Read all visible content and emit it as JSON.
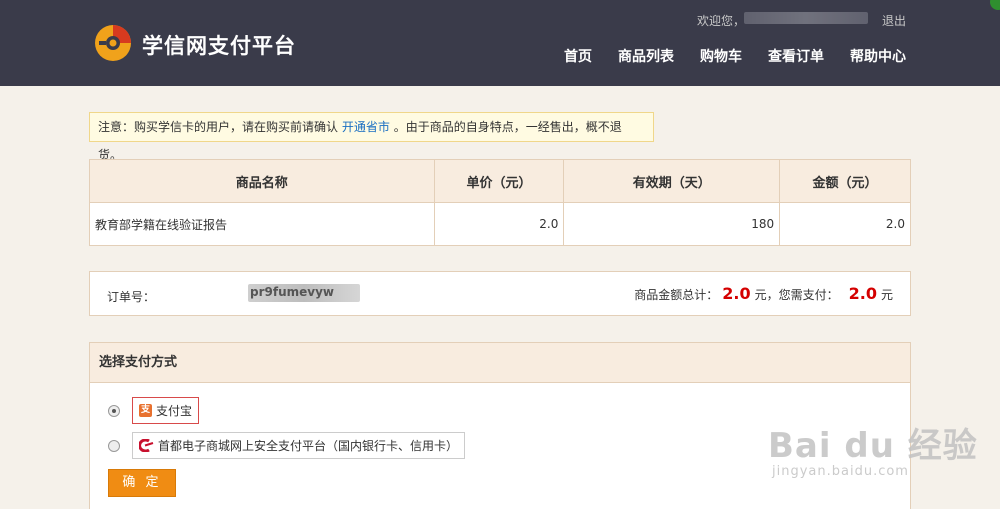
{
  "header": {
    "site_name": "学信网支付平台",
    "welcome": "欢迎您，",
    "logout": "退出",
    "nav": [
      "首页",
      "商品列表",
      "购物车",
      "查看订单",
      "帮助中心"
    ]
  },
  "notice": {
    "prefix": "注意：购买学信卡的用户，请在购买前请确认",
    "link": "开通省市",
    "suffix": "。由于商品的自身特点，一经售出，概不退货。"
  },
  "table": {
    "headers": [
      "商品名称",
      "单价（元）",
      "有效期（天）",
      "金额（元）"
    ],
    "rows": [
      {
        "name": "教育部学籍在线验证报告",
        "price": "2.0",
        "validity": "180",
        "amount": "2.0"
      }
    ]
  },
  "order": {
    "label": "订单号：",
    "number_partial": "pr9fumevyw",
    "total_label": "商品金额总计：",
    "total_value": "2.0",
    "total_unit": "元，您需支付：",
    "pay_value": "2.0",
    "pay_unit": "元"
  },
  "payment": {
    "title": "选择支付方式",
    "options": [
      {
        "label": "支付宝",
        "icon": "alipay-icon",
        "selected": true
      },
      {
        "label": "首都电子商城网上安全支付平台（国内银行卡、信用卡）",
        "icon": "capital-mall-icon",
        "selected": false
      }
    ],
    "confirm": "确 定"
  },
  "watermark": {
    "main": "Bai du 经验",
    "sub": "jingyan.baidu.com"
  },
  "colors": {
    "header_bg": "#3a3b4a",
    "accent": "#f08c13",
    "amount": "#d40000",
    "link": "#1b6fc2"
  }
}
